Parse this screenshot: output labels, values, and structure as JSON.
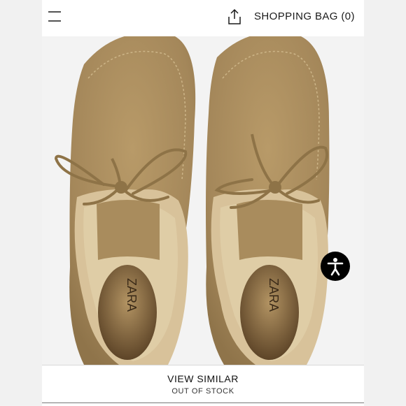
{
  "header": {
    "menu_icon": "hamburger-menu-icon",
    "share_icon": "share-upload-icon",
    "shopping_bag_label": "SHOPPING BAG (0)"
  },
  "product": {
    "image_description_icon": "suede-shearling-boots-photo",
    "brand_mark": "ZARA"
  },
  "accessibility": {
    "icon": "accessibility-person-icon"
  },
  "footer": {
    "view_similar_label": "VIEW SIMILAR",
    "stock_status": "OUT OF STOCK"
  },
  "colors": {
    "suede": "#a88a5a",
    "fur": "#d8c29a",
    "background": "#ffffff"
  }
}
